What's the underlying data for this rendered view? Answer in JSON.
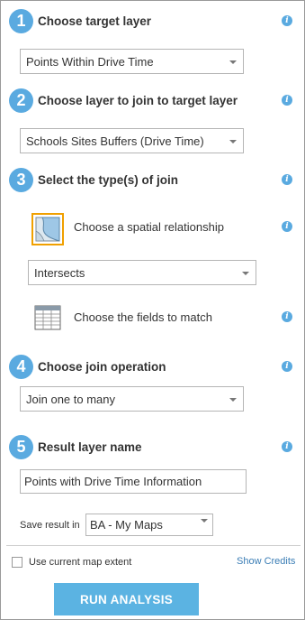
{
  "steps": [
    {
      "num": "1",
      "title": "Choose target layer",
      "value": "Points Within Drive Time"
    },
    {
      "num": "2",
      "title": "Choose layer to join to target layer",
      "value": "Schools Sites Buffers (Drive Time)"
    },
    {
      "num": "3",
      "title": "Select the type(s) of join"
    },
    {
      "num": "4",
      "title": "Choose join operation",
      "value": "Join one to many"
    },
    {
      "num": "5",
      "title": "Result layer name",
      "value": "Points with Drive Time Information"
    }
  ],
  "join": {
    "spatial_label": "Choose a spatial relationship",
    "spatial_value": "Intersects",
    "fields_label": "Choose the fields to match"
  },
  "info_glyph": "i",
  "save": {
    "label": "Save result in",
    "value": "BA - My Maps"
  },
  "extent_label": "Use current map extent",
  "credits_label": "Show Credits",
  "run_label": "RUN ANALYSIS",
  "colors": {
    "accent": "#5aaae0",
    "button": "#5bb3e2",
    "highlight": "#f0a000",
    "link": "#3a7db5"
  }
}
